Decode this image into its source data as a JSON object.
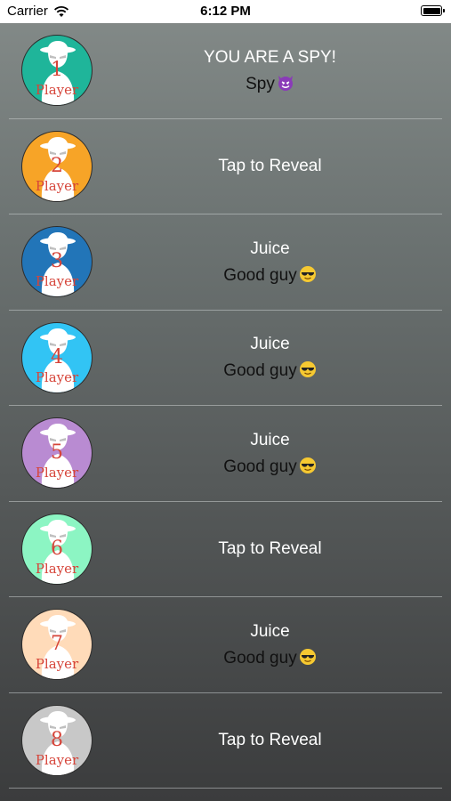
{
  "status_bar": {
    "carrier": "Carrier",
    "time": "6:12 PM"
  },
  "players": [
    {
      "number": "1",
      "label": "Player",
      "color": "#1fb59a",
      "line1": "YOU ARE A SPY!",
      "line2": "Spy",
      "emoji": "smiling-devil-icon"
    },
    {
      "number": "2",
      "label": "Player",
      "color": "#f7a427",
      "line1": "Tap to Reveal",
      "line2": "",
      "emoji": ""
    },
    {
      "number": "3",
      "label": "Player",
      "color": "#2275b8",
      "line1": "Juice",
      "line2": "Good guy",
      "emoji": "sunglasses-face-icon"
    },
    {
      "number": "4",
      "label": "Player",
      "color": "#32c4f4",
      "line1": "Juice",
      "line2": "Good guy",
      "emoji": "sunglasses-face-icon"
    },
    {
      "number": "5",
      "label": "Player",
      "color": "#b98bd2",
      "line1": "Juice",
      "line2": "Good guy",
      "emoji": "sunglasses-face-icon"
    },
    {
      "number": "6",
      "label": "Player",
      "color": "#8cf5c3",
      "line1": "Tap to Reveal",
      "line2": "",
      "emoji": ""
    },
    {
      "number": "7",
      "label": "Player",
      "color": "#ffdbb9",
      "line1": "Juice",
      "line2": "Good guy",
      "emoji": "sunglasses-face-icon"
    },
    {
      "number": "8",
      "label": "Player",
      "color": "#c8c8c8",
      "line1": "Tap to Reveal",
      "line2": "",
      "emoji": ""
    }
  ]
}
